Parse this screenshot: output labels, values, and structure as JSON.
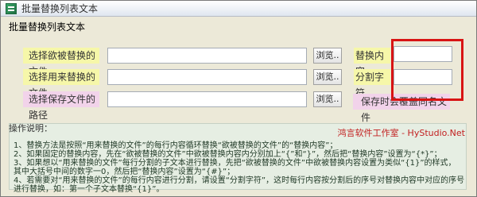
{
  "window": {
    "title": "批量替换列表文本",
    "icon": "app-list-icon"
  },
  "group": {
    "label": "批量替换列表文本"
  },
  "rows": [
    {
      "label": "选择欲被替换的文件",
      "browse_label": "浏览.."
    },
    {
      "label": "选择用来替换的文件",
      "browse_label": "浏览.."
    },
    {
      "label": "选择保存文件的路径",
      "browse_label": "浏览.."
    }
  ],
  "right_panel": {
    "replace_content_label": "替换内容",
    "separator_label": "分割字符",
    "overwrite_note": "保存时会覆盖同名文件"
  },
  "instructions": {
    "title": "操作说明：",
    "brand": "鸿言软件工作室 - HyStudio.Net",
    "lines": [
      "1、替换方法是按照“用来替换的文件”的每行内容循环替换“欲被替换的文件”的“替换内容”；",
      "2、如果固定的替换内容，先在“欲被替换的文件”中欲被替换内容内分别加上“{”和“}”，然后把“替换内容”设置为“{*}”；",
      "3、如果想以“用来替换的文件”每行分割的子文本进行替换，先把“欲被替换的文件”中欲被替换内容设置为类似“{1}”的样式，",
      "其中大括号中间的数字一0，然后把“替换内容”设置为“{#}”；",
      "4、若需要对“用来替换的文件”的每行内容进行分割，请设置“分割字符”，这时每行内容按分割后的序号对替换内容中对应的序号",
      "进行替换，如：第一个子文本替换“{1}”。"
    ]
  },
  "colors": {
    "label_yellow": "#f6f7a9",
    "label_pink": "#f2d3ea",
    "highlight": "#d81414",
    "brand_red": "#c21f1f"
  }
}
